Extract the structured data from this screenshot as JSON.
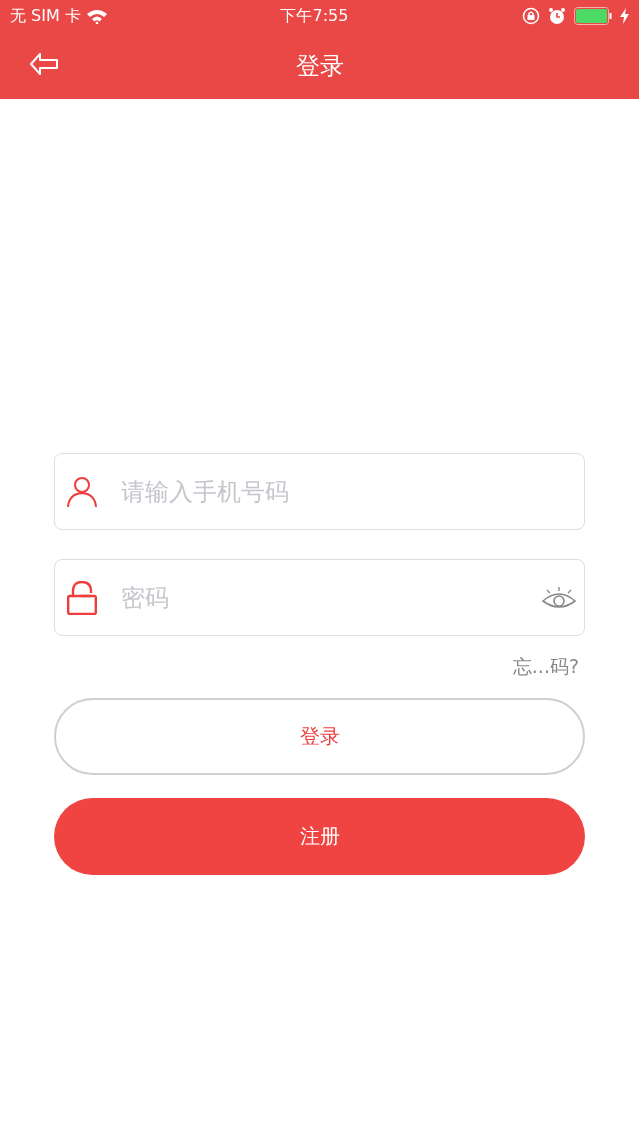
{
  "status_bar": {
    "carrier": "无 SIM 卡",
    "time": "下午7:55"
  },
  "nav_bar": {
    "title": "登录"
  },
  "fields": [
    {
      "kind": "phone",
      "placeholder": "请输入手机号码"
    },
    {
      "kind": "password",
      "placeholder": "密码"
    }
  ],
  "forgot_link": "忘...码?",
  "buttons": [
    {
      "kind": "outline",
      "label": "登录"
    },
    {
      "kind": "filled",
      "label": "注册"
    }
  ]
}
